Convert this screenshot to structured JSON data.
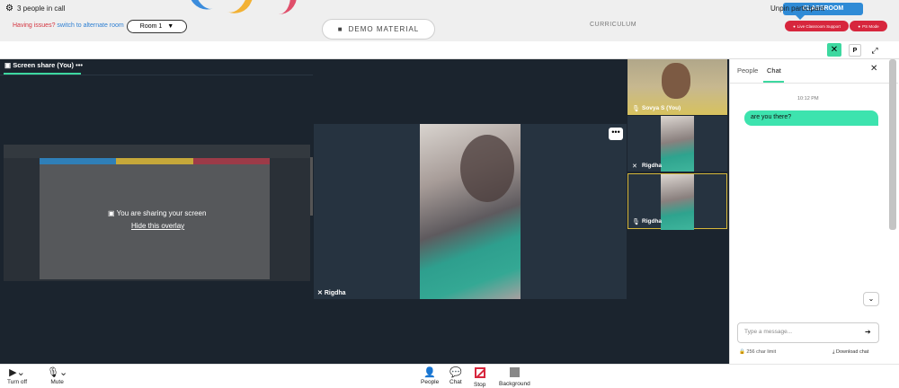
{
  "header": {
    "issues_text": "Having issues?",
    "issues_link": "switch to alternate room",
    "room_select": "Room 1",
    "demo_material": "DEMO MATERIAL",
    "curriculum": "CURRICULUM",
    "classroom_tab": "CLASSROOM",
    "live_support": "Live Classroom Support",
    "ps_mode": "PS Mode"
  },
  "callbar": {
    "people_in_call": "3 people in call",
    "unpin": "Unpin participant",
    "p_label": "P"
  },
  "screen_share": {
    "title": "Screen share (You)",
    "sharing_text": "You are sharing your screen",
    "hide_overlay": "Hide this overlay",
    "stripe_colors": [
      "#2f7fb8",
      "#c6a83a",
      "#9c3b48"
    ]
  },
  "main_video": {
    "participant": "Rigdha",
    "menu_dots": "•••"
  },
  "side_tiles": [
    {
      "name": "Sovya S (You)"
    },
    {
      "name": "Rigdha"
    },
    {
      "name": "Rigdha"
    }
  ],
  "chat": {
    "tab_people": "People",
    "tab_chat": "Chat",
    "time": "10:12 PM",
    "message": "are you there?",
    "placeholder": "Type a message...",
    "char_limit": "256 char limit",
    "download": "Download chat"
  },
  "toolbar": {
    "turn_off": "Turn off",
    "mute": "Mute",
    "people": "People",
    "chat": "Chat",
    "stop": "Stop",
    "background": "Background"
  },
  "colors": {
    "accent": "#3dd8a0",
    "stage_bg": "#1b242e",
    "alert_red": "#d7263d",
    "link_blue": "#2d7fd3"
  }
}
